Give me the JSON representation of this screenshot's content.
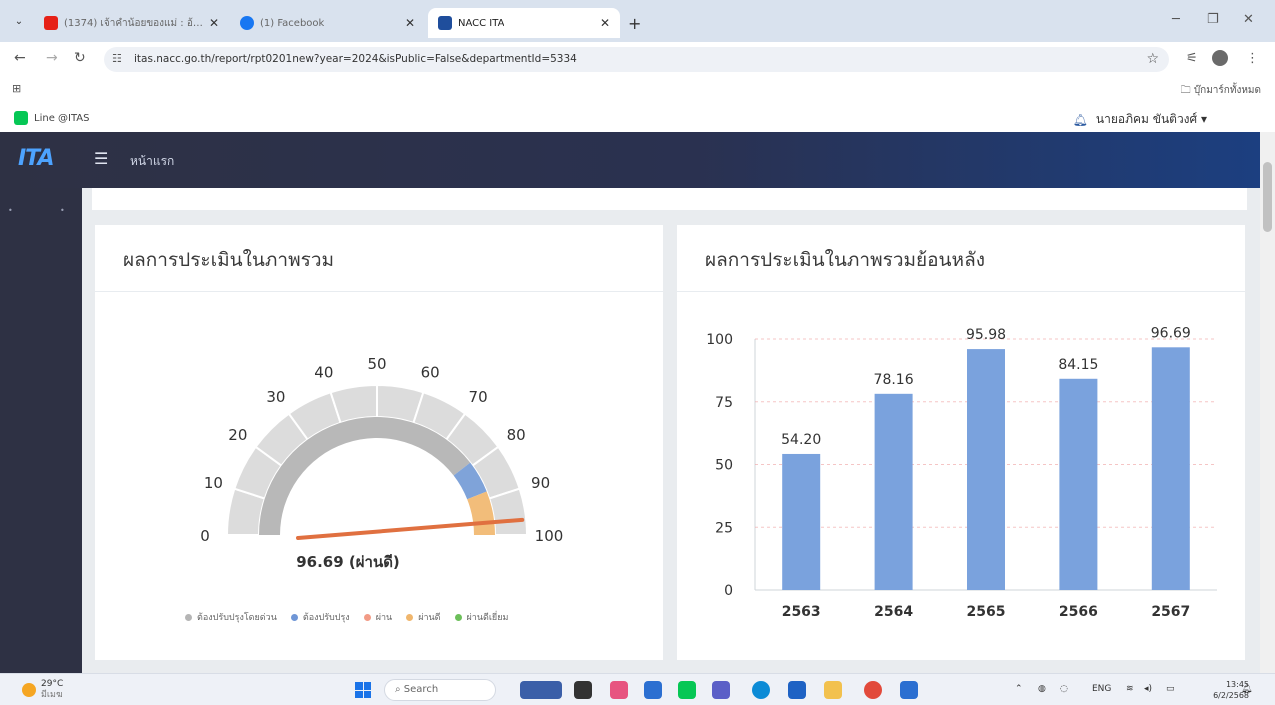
{
  "browser": {
    "tabs": [
      {
        "title": "(1374) เจ้าคำน้อยของแม่ : อ้อ...",
        "active": false,
        "favicon_color": "#e62117"
      },
      {
        "title": "(1) Facebook",
        "active": false,
        "favicon_color": "#1877f2"
      },
      {
        "title": "NACC ITA",
        "active": true,
        "favicon_color": "#1f4e9c"
      }
    ],
    "url": "itas.nacc.go.th/report/rpt0201new?year=2024&isPublic=False&departmentId=5334",
    "bookmark_folder": "บุ๊กมาร์กทั้งหมด"
  },
  "page_header": {
    "line_link": "Line @ITAS",
    "user_name": "นายอภิคม ขันติวงศ์ ▾"
  },
  "app_nav": {
    "logo": "ITA",
    "home_label": "หน้าแรก"
  },
  "gauge_card": {
    "title": "ผลการประเมินในภาพรวม",
    "score_label": "96.69 (ผ่านดี)",
    "score": 96.69,
    "tick_labels": [
      "0",
      "10",
      "20",
      "30",
      "40",
      "50",
      "60",
      "70",
      "80",
      "90",
      "100"
    ],
    "band_colors": {
      "grey": "#b8b8b8",
      "blue": "#7fa3d9",
      "orange": "#f2bd7a"
    },
    "needle_color": "#e07040",
    "legend": [
      {
        "label": "ต้องปรับปรุงโดยด่วน",
        "color": "#b5b5b5"
      },
      {
        "label": "ต้องปรับปรุง",
        "color": "#6f96d6"
      },
      {
        "label": "ผ่าน",
        "color": "#f29b86"
      },
      {
        "label": "ผ่านดี",
        "color": "#f0b66d"
      },
      {
        "label": "ผ่านดีเยี่ยม",
        "color": "#6cbf5a"
      }
    ]
  },
  "bar_card": {
    "title": "ผลการประเมินในภาพรวมย้อนหลัง"
  },
  "chart_data": {
    "type": "bar",
    "title": "ผลการประเมินในภาพรวมย้อนหลัง",
    "categories": [
      "2563",
      "2564",
      "2565",
      "2566",
      "2567"
    ],
    "values": [
      54.2,
      78.16,
      95.98,
      84.15,
      96.69
    ],
    "value_labels": [
      "54.20",
      "78.16",
      "95.98",
      "84.15",
      "96.69"
    ],
    "ylim": [
      0,
      100
    ],
    "yticks": [
      "0",
      "25",
      "50",
      "75",
      "100"
    ],
    "grid": true,
    "bar_color": "#7aa2dd",
    "gridline_color": "#f0a0a0"
  },
  "taskbar": {
    "weather_temp": "29°C",
    "weather_desc": "มีเมฆ",
    "search_label": "Search",
    "tray_lang": "ENG",
    "time": "13:45",
    "date": "6/2/2568"
  }
}
